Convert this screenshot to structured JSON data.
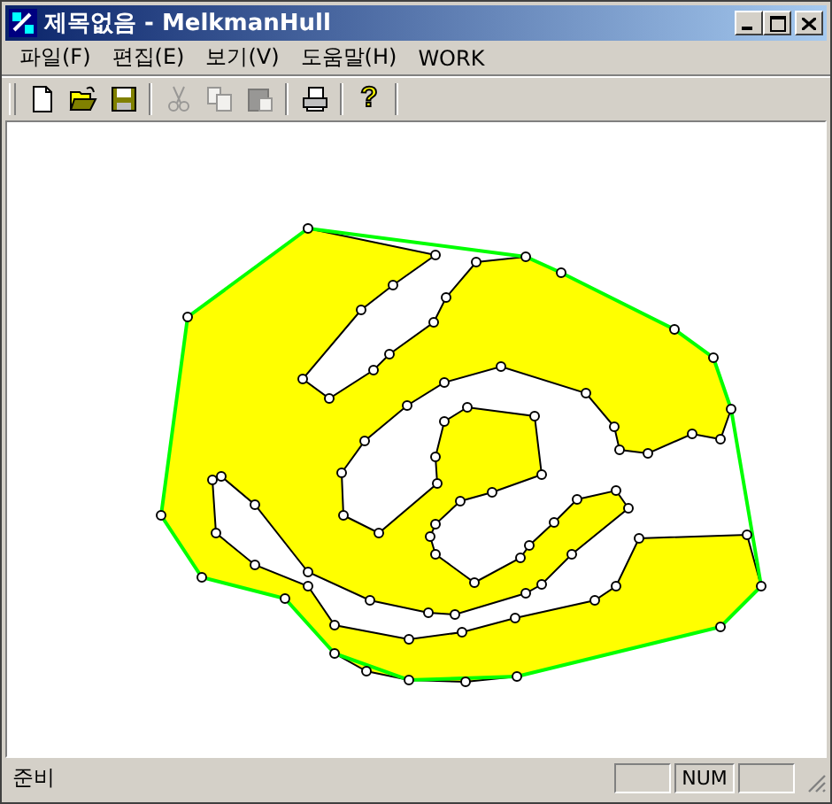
{
  "window": {
    "title": "제목없음 - MelkmanHull"
  },
  "menu": [
    "파일(F)",
    "편집(E)",
    "보기(V)",
    "도움말(H)",
    "WORK"
  ],
  "toolbar": [
    {
      "kind": "new",
      "disabled": false
    },
    {
      "kind": "open",
      "disabled": false
    },
    {
      "kind": "save",
      "disabled": false
    },
    {
      "kind": "separator"
    },
    {
      "kind": "cut",
      "disabled": true
    },
    {
      "kind": "copy",
      "disabled": true
    },
    {
      "kind": "paste",
      "disabled": true
    },
    {
      "kind": "separator"
    },
    {
      "kind": "print",
      "disabled": false
    },
    {
      "kind": "separator"
    },
    {
      "kind": "help",
      "glyph": "?"
    }
  ],
  "status_bar": {
    "text": "준비",
    "indicators": [
      "NUM"
    ]
  }
}
